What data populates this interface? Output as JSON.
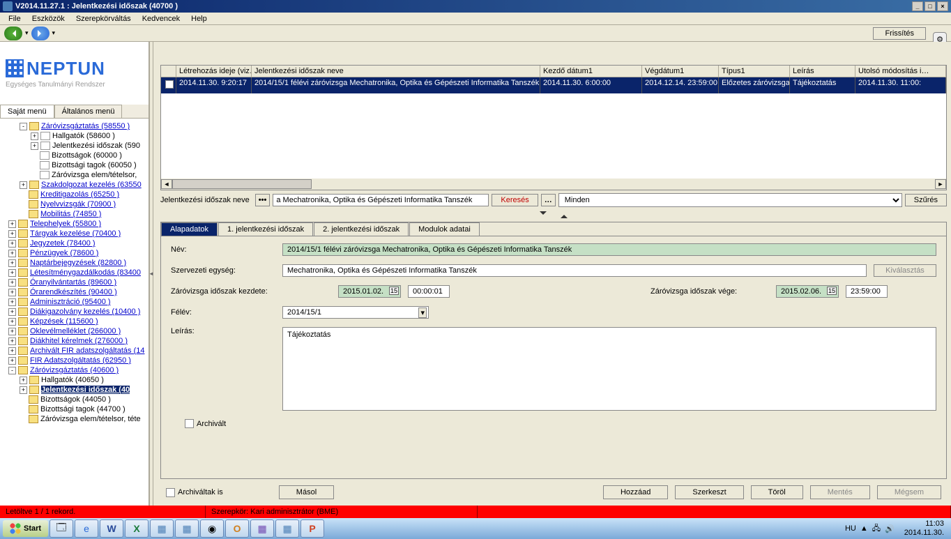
{
  "window": {
    "title": "V2014.11.27.1 : Jelentkezési időszak (40700  )",
    "min": "_",
    "max": "□",
    "close": "×"
  },
  "menubar": [
    "File",
    "Eszközök",
    "Szerepkörváltás",
    "Kedvencek",
    "Help"
  ],
  "toolbar": {
    "refresh": "Frissítés"
  },
  "logo": {
    "brand": "NEPTUN",
    "subtitle": "Egységes Tanulmányi Rendszer"
  },
  "menutabs": {
    "own": "Saját menü",
    "general": "Általános menü"
  },
  "tree": [
    {
      "depth": 1,
      "exp": "-",
      "icon": "f",
      "link": true,
      "label": "Záróvizsgáztatás (58550  )"
    },
    {
      "depth": 2,
      "exp": "+",
      "icon": "p",
      "link": false,
      "label": "Hallgatók (58600  )"
    },
    {
      "depth": 2,
      "exp": "+",
      "icon": "p",
      "link": false,
      "label": "Jelentkezési időszak (590"
    },
    {
      "depth": 2,
      "exp": "",
      "icon": "p",
      "link": false,
      "label": "Bizottságok (60000  )"
    },
    {
      "depth": 2,
      "exp": "",
      "icon": "p",
      "link": false,
      "label": "Bizottsági tagok (60050  )"
    },
    {
      "depth": 2,
      "exp": "",
      "icon": "p",
      "link": false,
      "label": "Záróvizsga elem/tételsor,"
    },
    {
      "depth": 1,
      "exp": "+",
      "icon": "f",
      "link": true,
      "label": "Szakdolgozat kezelés (63550"
    },
    {
      "depth": 1,
      "exp": "",
      "icon": "f",
      "link": true,
      "label": "Kreditigazolás (65250  )"
    },
    {
      "depth": 1,
      "exp": "",
      "icon": "f",
      "link": true,
      "label": "Nyelvvizsgák (70900  )"
    },
    {
      "depth": 1,
      "exp": "",
      "icon": "f",
      "link": true,
      "label": "Mobilitás (74850  )"
    },
    {
      "depth": 0,
      "exp": "+",
      "icon": "f",
      "link": true,
      "label": "Telephelyek (55800  )"
    },
    {
      "depth": 0,
      "exp": "+",
      "icon": "f",
      "link": true,
      "label": "Tárgyak kezelése (70400  )"
    },
    {
      "depth": 0,
      "exp": "+",
      "icon": "f",
      "link": true,
      "label": "Jegyzetek (78400  )"
    },
    {
      "depth": 0,
      "exp": "+",
      "icon": "f",
      "link": true,
      "label": "Pénzügyek (78600  )"
    },
    {
      "depth": 0,
      "exp": "+",
      "icon": "f",
      "link": true,
      "label": "Naptárbejegyzések (82800  )"
    },
    {
      "depth": 0,
      "exp": "+",
      "icon": "f",
      "link": true,
      "label": "Létesítménygazdálkodás (83400"
    },
    {
      "depth": 0,
      "exp": "+",
      "icon": "f",
      "link": true,
      "label": "Óranyilvántartás (89600  )"
    },
    {
      "depth": 0,
      "exp": "+",
      "icon": "f",
      "link": true,
      "label": "Órarendkészítés (90400  )"
    },
    {
      "depth": 0,
      "exp": "+",
      "icon": "f",
      "link": true,
      "label": "Adminisztráció (95400  )"
    },
    {
      "depth": 0,
      "exp": "+",
      "icon": "f",
      "link": true,
      "label": "Diákigazolvány kezelés (10400  )"
    },
    {
      "depth": 0,
      "exp": "+",
      "icon": "f",
      "link": true,
      "label": "Képzések (115600  )"
    },
    {
      "depth": 0,
      "exp": "+",
      "icon": "f",
      "link": true,
      "label": "Oklevélmelléklet (266000  )"
    },
    {
      "depth": 0,
      "exp": "+",
      "icon": "f",
      "link": true,
      "label": "Diákhitel kérelmek (276000  )"
    },
    {
      "depth": 0,
      "exp": "+",
      "icon": "f",
      "link": true,
      "label": "Archivált FIR adatszolgáltatás (14"
    },
    {
      "depth": 0,
      "exp": "+",
      "icon": "f",
      "link": true,
      "label": "FIR Adatszolgáltatás (62950  )"
    },
    {
      "depth": 0,
      "exp": "-",
      "icon": "f",
      "link": true,
      "label": "Záróvizsgáztatás (40600  )"
    },
    {
      "depth": 1,
      "exp": "+",
      "icon": "f",
      "link": false,
      "label": "Hallgatók (40650  )"
    },
    {
      "depth": 1,
      "exp": "+",
      "icon": "f",
      "link": false,
      "label": "Jelentkezési időszak (40",
      "selected": true
    },
    {
      "depth": 1,
      "exp": "",
      "icon": "f",
      "link": false,
      "label": "Bizottságok (44050  )"
    },
    {
      "depth": 1,
      "exp": "",
      "icon": "f",
      "link": false,
      "label": "Bizottsági tagok (44700  )"
    },
    {
      "depth": 1,
      "exp": "",
      "icon": "f",
      "link": false,
      "label": "Záróvizsga elem/tételsor, téte"
    }
  ],
  "grid": {
    "headers": [
      "",
      "Létrehozás ideje (viz…",
      "Jelentkezési időszak neve",
      "Kezdő dátum1",
      "Végdátum1",
      "Típus1",
      "Leírás",
      "Utolsó módosítás i…"
    ],
    "widths": [
      22,
      108,
      414,
      146,
      110,
      102,
      94,
      130
    ],
    "row": [
      "",
      "2014.11.30. 9:20:17",
      "2014/15/1 félévi záróvizsga Mechatronika, Optika és Gépészeti Informatika Tanszék",
      "2014.11.30. 6:00:00",
      "2014.12.14. 23:59:00",
      "Előzetes záróvizsga",
      "Tájékoztatás",
      "2014.11.30. 11:00:"
    ]
  },
  "search": {
    "label": "Jelentkezési időszak neve",
    "value": "a Mechatronika, Optika és Gépészeti Informatika Tanszék",
    "btnSearch": "Keresés",
    "selectValue": "Minden",
    "btnFilter": "Szűrés"
  },
  "detailTabs": [
    "Alapadatok",
    "1. jelentkezési időszak",
    "2. jelentkezési időszak",
    "Modulok adatai"
  ],
  "form": {
    "nameLbl": "Név:",
    "nameVal": "2014/15/1 félévi záróvizsga Mechatronika, Optika és Gépészeti Informatika Tanszék",
    "unitLbl": "Szervezeti egység:",
    "unitVal": "Mechatronika, Optika és Gépészeti Informatika Tanszék",
    "selectBtn": "Kiválasztás",
    "startLbl": "Záróvizsga időszak kezdete:",
    "startDate": "2015.01.02.",
    "startTime": "00:00:01",
    "endLbl": "Záróvizsga időszak vége:",
    "endDate": "2015.02.06.",
    "endTime": "23:59:00",
    "semLbl": "Félév:",
    "semVal": "2014/15/1",
    "descLbl": "Leírás:",
    "descVal": "Tájékoztatás",
    "archivedLbl": "Archivált"
  },
  "bottom": {
    "archivedAlso": "Archiváltak is",
    "copy": "Másol",
    "add": "Hozzáad",
    "edit": "Szerkeszt",
    "delete": "Töröl",
    "save": "Mentés",
    "cancel": "Mégsem"
  },
  "status": {
    "loaded": "Letöltve 1 / 1 rekord.",
    "role": "Szerepkör: Kari adminisztrátor (BME)"
  },
  "taskbar": {
    "start": "Start",
    "lang": "HU",
    "time": "11:03",
    "date": "2014.11.30."
  }
}
